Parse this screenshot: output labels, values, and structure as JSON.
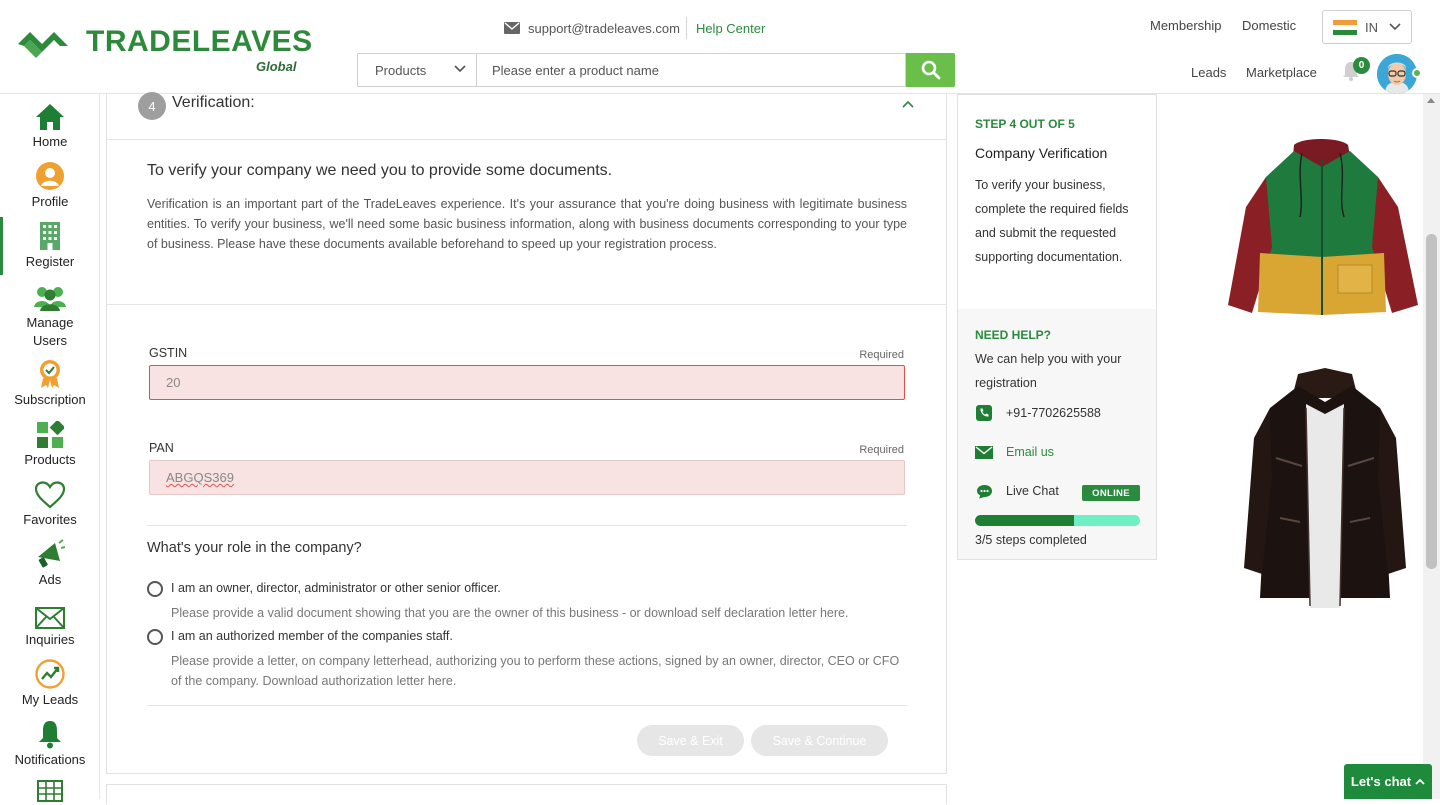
{
  "header": {
    "logo_text": "TRADELEAVES",
    "logo_sub": "Global",
    "support_email": "support@tradeleaves.com",
    "help_center": "Help Center",
    "search": {
      "category": "Products",
      "placeholder": "Please enter a product name"
    },
    "nav": {
      "membership": "Membership",
      "domestic": "Domestic",
      "leads": "Leads",
      "marketplace": "Marketplace"
    },
    "language": "IN",
    "notification_count": "0"
  },
  "sidebar": {
    "items": [
      {
        "label": "Home",
        "icon": "home-icon"
      },
      {
        "label": "Profile",
        "icon": "profile-icon"
      },
      {
        "label": "Register",
        "icon": "building-icon",
        "active": true
      },
      {
        "label": "Manage Users",
        "icon": "users-icon"
      },
      {
        "label": "Subscription",
        "icon": "subscription-icon"
      },
      {
        "label": "Products",
        "icon": "products-icon"
      },
      {
        "label": "Favorites",
        "icon": "heart-icon"
      },
      {
        "label": "Ads",
        "icon": "megaphone-icon"
      },
      {
        "label": "Inquiries",
        "icon": "envelope-icon"
      },
      {
        "label": "My Leads",
        "icon": "leads-icon"
      },
      {
        "label": "Notifications",
        "icon": "bell-icon"
      }
    ]
  },
  "step": {
    "number": "4",
    "title": "Verification:"
  },
  "intro": {
    "title": "To verify your company we need you to provide some documents.",
    "text": "Verification is an important part of the TradeLeaves experience. It's your assurance that you're doing business with legitimate business entities. To verify your business, we'll need some basic business information, along with business documents corresponding to your type of business. Please have these documents available beforehand to speed up your registration process."
  },
  "form": {
    "gstin": {
      "label": "GSTIN",
      "required": "Required",
      "value": "20"
    },
    "pan": {
      "label": "PAN",
      "required": "Required",
      "value": "ABGQS369"
    },
    "role_title": "What's your role in the company?",
    "roles": [
      {
        "label": "I am an owner, director, administrator or other senior officer.",
        "help": "Please provide a valid document showing that you are the owner of this business - or download self declaration letter here."
      },
      {
        "label": "I am an authorized member of the companies staff.",
        "help": "Please provide a letter, on company letterhead, authorizing you to perform these actions, signed by an owner, director, CEO or CFO of the company. Download authorization letter here."
      }
    ],
    "save_exit": "Save & Exit",
    "save_continue": "Save & Continue"
  },
  "panel": {
    "step": "STEP 4 OUT OF 5",
    "title": "Company Verification",
    "text": "To verify your business, complete the required fields and submit the requested supporting documentation.",
    "need_help": "NEED HELP?",
    "help_text": "We can help you with your registration",
    "phone": "+91-7702625588",
    "email": "Email us",
    "live_chat": "Live Chat",
    "online": "ONLINE",
    "progress_fraction": 0.6,
    "steps_completed": "3/5 steps completed"
  },
  "chat_button": "Let's chat",
  "colors": {
    "brand_green": "#2b8a3e",
    "search_green": "#6abf4b",
    "error_red": "#d9534f",
    "error_bg": "#f9e2e2"
  }
}
